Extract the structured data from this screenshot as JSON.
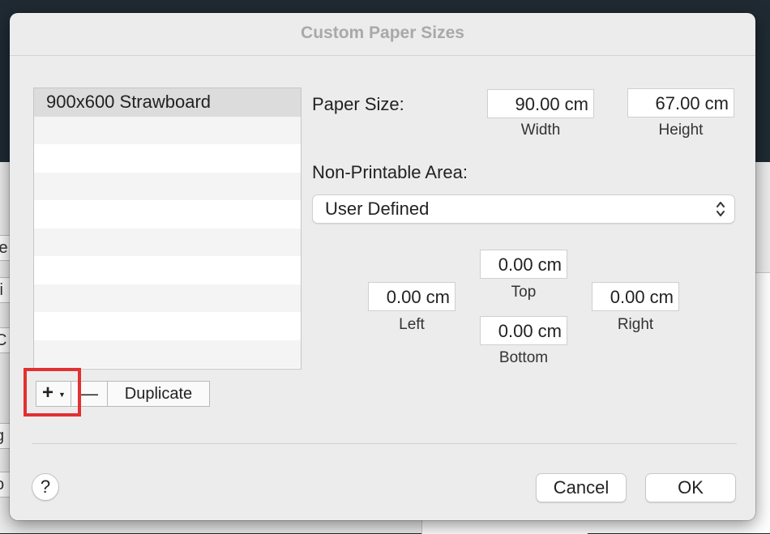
{
  "background": {
    "fragments": [
      "le",
      "fi",
      "C",
      "g",
      "o"
    ]
  },
  "dialog": {
    "title": "Custom Paper Sizes",
    "paper_list": {
      "items": [
        "900x600 Strawboard"
      ],
      "selected_index": 0
    },
    "list_buttons": {
      "add_label": "+",
      "add_dropdown_icon": "caret-down-icon",
      "remove_label": "—",
      "duplicate_label": "Duplicate"
    },
    "paper_size": {
      "label": "Paper Size:",
      "width_value": "90.00 cm",
      "width_caption": "Width",
      "height_value": "67.00 cm",
      "height_caption": "Height"
    },
    "non_printable": {
      "label": "Non-Printable Area:",
      "selected": "User Defined",
      "top_value": "0.00 cm",
      "top_caption": "Top",
      "left_value": "0.00 cm",
      "left_caption": "Left",
      "right_value": "0.00 cm",
      "right_caption": "Right",
      "bottom_value": "0.00 cm",
      "bottom_caption": "Bottom"
    },
    "footer": {
      "help_label": "?",
      "cancel_label": "Cancel",
      "ok_label": "OK"
    }
  },
  "colors": {
    "highlight": "#e33030",
    "title_text": "#a9a9a9",
    "dialog_bg": "#ececec"
  }
}
